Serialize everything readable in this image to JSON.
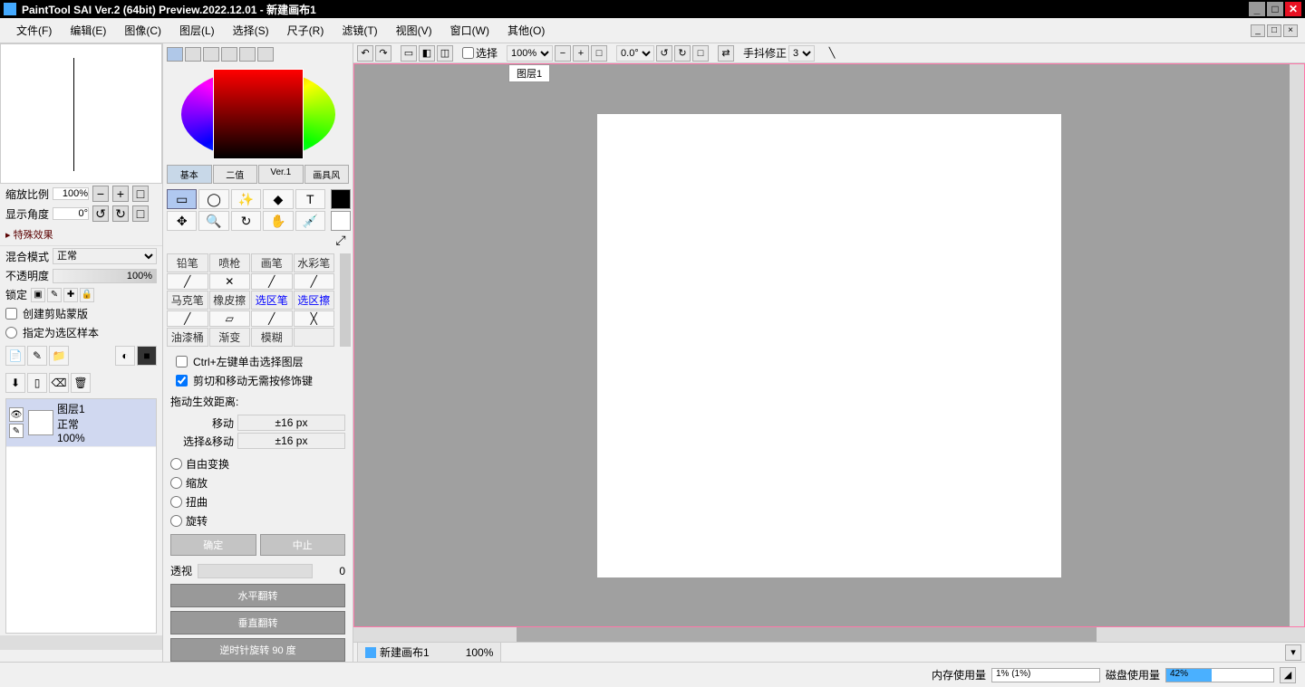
{
  "title": "PaintTool SAI Ver.2 (64bit) Preview.2022.12.01 - 新建画布1",
  "menu": [
    "文件(F)",
    "编辑(E)",
    "图像(C)",
    "图层(L)",
    "选择(S)",
    "尺子(R)",
    "滤镜(T)",
    "视图(V)",
    "窗口(W)",
    "其他(O)"
  ],
  "nav": {
    "zoom_label": "缩放比例",
    "zoom_value": "100%",
    "angle_label": "显示角度",
    "angle_value": "0°"
  },
  "fx_head": "▸ 特殊效果",
  "blend": {
    "label": "混合模式",
    "value": "正常"
  },
  "opacity": {
    "label": "不透明度",
    "value": "100%"
  },
  "lock": {
    "label": "锁定"
  },
  "clip": "创建剪贴蒙版",
  "sel_src": "指定为选区样本",
  "layer": {
    "name": "图层1",
    "mode": "正常",
    "opacity": "100%"
  },
  "mini_tabs": [
    "基本",
    "二值",
    "Ver.1",
    "画具风"
  ],
  "brushes": {
    "row1": [
      "铅笔",
      "喷枪",
      "画笔",
      "水彩笔"
    ],
    "row2": [
      "马克笔",
      "橡皮擦",
      "选区笔",
      "选区擦"
    ],
    "row3": [
      "油漆桶",
      "渐变",
      "模糊",
      ""
    ]
  },
  "opts": {
    "ctrl_click": "Ctrl+左键单击选择图层",
    "cut_move": "剪切和移动无需按修饰键",
    "drag_head": "拖动生效距离:",
    "move": "移动",
    "move_val": "±16 px",
    "selmove": "选择&移动",
    "selmove_val": "±16 px"
  },
  "transform": {
    "free": "自由变换",
    "scale": "缩放",
    "distort": "扭曲",
    "rotate": "旋转",
    "ok": "确定",
    "cancel": "中止"
  },
  "persp": {
    "label": "透视",
    "value": "0"
  },
  "flip": {
    "h": "水平翻转",
    "v": "垂直翻转",
    "r90": "逆时针旋转 90 度"
  },
  "toolbar": {
    "select_label": "选择",
    "zoom": "100%",
    "angle": "0.0°",
    "stab_label": "手抖修正",
    "stab_value": "3"
  },
  "canvas_title": "图层1",
  "doc_tab": {
    "name": "新建画布1",
    "zoom": "100%"
  },
  "status": {
    "mem_label": "内存使用量",
    "mem_val": "1% (1%)",
    "disk_label": "磁盘使用量",
    "disk_val": "42%",
    "disk_fill": 42
  }
}
